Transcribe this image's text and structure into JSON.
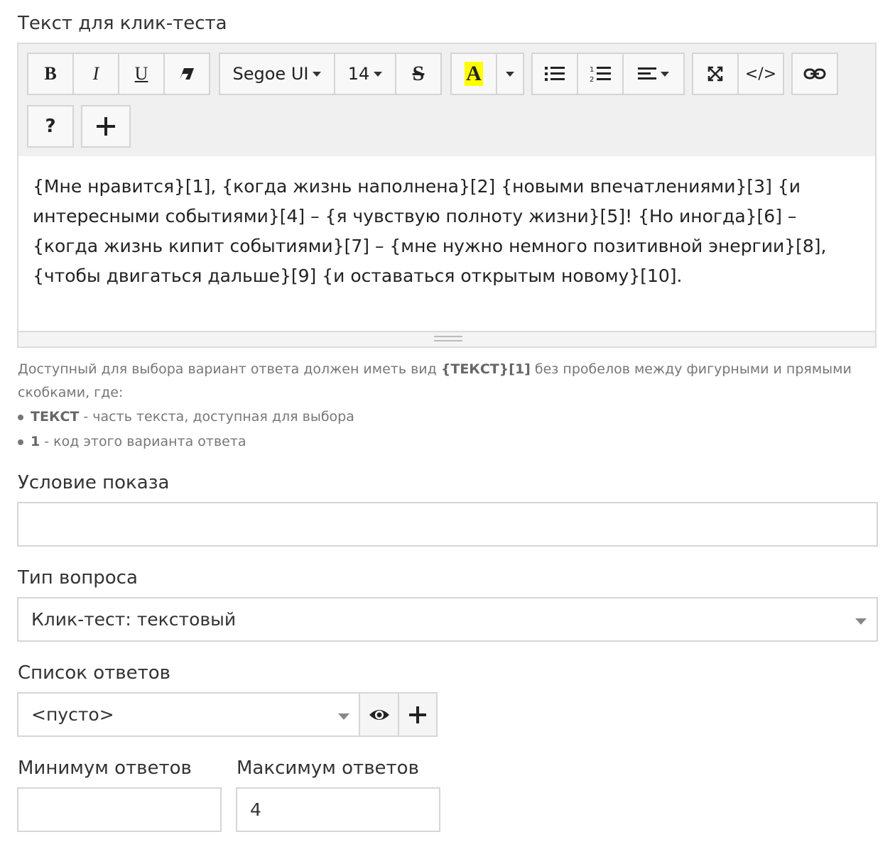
{
  "editor_label": "Текст для клик-теста",
  "toolbar": {
    "bold": "B",
    "italic": "I",
    "underline": "U",
    "font_family": "Segoe UI",
    "font_size": "14",
    "strike": "S",
    "highlight_letter": "A",
    "code": "</>",
    "help": "?"
  },
  "content": "{Мне нравится}[1], {когда жизнь наполнена}[2] {новыми впечатлениями}[3] {и интересными событиями}[4] – {я чувствую полноту жизни}[5]! {Но иногда}[6] – {когда жизнь кипит событиями}[7] – {мне нужно немного позитивной энергии}[8], {чтобы двигаться дальше}[9] {и оставаться открытым новому}[10].",
  "help": {
    "line1_pre": "Доступный для выбора вариант ответа должен иметь вид ",
    "line1_code": "{ТЕКСТ}[1]",
    "line1_post": " без пробелов между фигурными и прямыми скобками, где:",
    "bullets": [
      {
        "term": "ТЕКСТ",
        "desc": " - часть текста, доступная для выбора"
      },
      {
        "term": "1",
        "desc": " - код этого варианта ответа"
      }
    ]
  },
  "condition": {
    "label": "Условие показа",
    "value": ""
  },
  "question_type": {
    "label": "Тип вопроса",
    "value": "Клик-тест: текстовый"
  },
  "answers": {
    "label": "Список ответов",
    "value": "<пусто>"
  },
  "min_answers": {
    "label": "Минимум ответов",
    "value": ""
  },
  "max_answers": {
    "label": "Максимум ответов",
    "value": "4"
  },
  "colors": {
    "highlight": "#ffff00",
    "border": "#d6d6d6",
    "toolbar_bg": "#f0f0f0"
  }
}
